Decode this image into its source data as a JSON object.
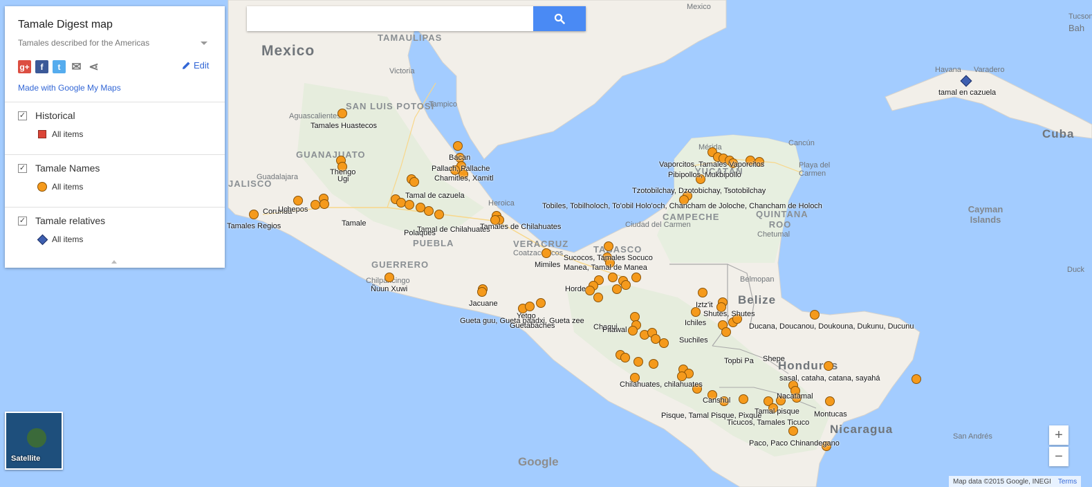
{
  "panel": {
    "title": "Tamale Digest map",
    "subtitle": "Tamales described for the Americas",
    "edit_label": "Edit",
    "made_with": "Made with Google My Maps",
    "social": [
      {
        "icon": "google-plus-icon",
        "glyph": "g+",
        "color": "#dc4e41"
      },
      {
        "icon": "facebook-icon",
        "glyph": "f",
        "color": "#3b5998"
      },
      {
        "icon": "twitter-icon",
        "glyph": "t",
        "color": "#55acee"
      },
      {
        "icon": "email-icon",
        "glyph": "✉",
        "color": "#7a7a7a"
      },
      {
        "icon": "share-icon",
        "glyph": "⋖",
        "color": "#7a7a7a"
      }
    ],
    "layers": [
      {
        "name": "Historical",
        "item_label": "All items",
        "legend_shape": "square",
        "legend_color": "#db4436"
      },
      {
        "name": "Tamale Names",
        "item_label": "All items",
        "legend_shape": "circle",
        "legend_color": "#f59a1c"
      },
      {
        "name": "Tamale relatives",
        "item_label": "All items",
        "legend_shape": "diamond",
        "legend_color": "#3e5fb0"
      }
    ]
  },
  "search": {
    "placeholder": "",
    "button_icon": "search-icon"
  },
  "map": {
    "places": [
      {
        "text": "Mexico",
        "kind": "country"
      },
      {
        "text": "TAMAULIPAS",
        "kind": "state"
      },
      {
        "text": "SAN LUIS POTOSÍ",
        "kind": "state"
      },
      {
        "text": "GUANAJUATO",
        "kind": "state"
      },
      {
        "text": "JALISCO",
        "kind": "state"
      },
      {
        "text": "PUEBLA",
        "kind": "state"
      },
      {
        "text": "GUERRERO",
        "kind": "state"
      },
      {
        "text": "VERACRUZ",
        "kind": "state"
      },
      {
        "text": "TABASCO",
        "kind": "state"
      },
      {
        "text": "CAMPECHE",
        "kind": "state"
      },
      {
        "text": "QUINTANA ROO",
        "kind": "state"
      },
      {
        "text": "YUCATÁN",
        "kind": "state"
      },
      {
        "text": "Belize",
        "kind": "country"
      },
      {
        "text": "Honduras",
        "kind": "country"
      },
      {
        "text": "Nicaragua",
        "kind": "country"
      },
      {
        "text": "Cuba",
        "kind": "country"
      },
      {
        "text": "Cayman Islands",
        "kind": "island"
      },
      {
        "text": "Victoria",
        "kind": "city"
      },
      {
        "text": "Tampico",
        "kind": "city"
      },
      {
        "text": "Aguascalientes",
        "kind": "city"
      },
      {
        "text": "Guadalajara",
        "kind": "city"
      },
      {
        "text": "Heroica",
        "kind": "city"
      },
      {
        "text": "Coatzacoalcos",
        "kind": "city"
      },
      {
        "text": "Chilpancingo",
        "kind": "city"
      },
      {
        "text": "Ciudad del Carmen",
        "kind": "city"
      },
      {
        "text": "Cancún",
        "kind": "city"
      },
      {
        "text": "Playa del Carmen",
        "kind": "city"
      },
      {
        "text": "Chetumal",
        "kind": "city"
      },
      {
        "text": "Belmopan",
        "kind": "city"
      },
      {
        "text": "Havana",
        "kind": "city"
      },
      {
        "text": "Varadero",
        "kind": "city"
      },
      {
        "text": "Mérida",
        "kind": "city"
      },
      {
        "text": "San Andrés",
        "kind": "city"
      },
      {
        "text": "Mexico",
        "kind": "city"
      },
      {
        "text": "Bah",
        "kind": "city"
      },
      {
        "text": "Duck",
        "kind": "city"
      },
      {
        "text": "Tucson",
        "kind": "city"
      }
    ],
    "labels": [
      "Tamales Huastecos",
      "Tamales Regios",
      "Ñuun Xuwi",
      "Bacan",
      "Pallach, Pallache",
      "Chamitles, Xamitl",
      "Tamal de cazuela",
      "Tamal de Chilahuates",
      "Tamales de Chilahuates",
      "Tobiles, Tobilholoch, To'obil Holo'och, Chancham de Joloche,  Chancham de Holoch",
      "Tzotobilchay, Dzotobichay, Tsotobilchay",
      "Vaporcitos, Tamales Vaporcitos",
      "Pibipollos, Mukbipollo",
      "Mimiles",
      "Sucocos, Tamales Socuco",
      "Manea, Tamal de Manea",
      "Gueta guu, Gueta paadxi, Gueta zee",
      "Guetabaches",
      "Yetgo",
      "Jacuane",
      "Iztz'it",
      "Ichiles",
      "Shutes, Shutes",
      "Ducana, Doucanou, Doukouna, Dukunu, Ducunu",
      "sasal, cataha, catana, sayahá",
      "Nacatamal",
      "Montucas",
      "Canshul",
      "Pisque, Tamal Pisque, Pixque",
      "Ticucos, Tamales Ticuco",
      "Paco, Paco Chinandegano",
      "Chilahuates, chilahuates",
      "Tamale",
      "tamal en cazuela",
      "Thengo",
      "Ugi",
      "Corunda",
      "Uchepos",
      "Polaques",
      "Horde",
      "Chaqui",
      "Pitawal",
      "Suchiles",
      "Topbi Pa",
      "Shepe",
      "Tamal pisque"
    ]
  },
  "satellite_label": "Satellite",
  "zoom": {
    "in": "+",
    "out": "−"
  },
  "footer": {
    "attribution": "Map data ©2015 Google, INEGI",
    "terms": "Terms"
  },
  "logo": "Google"
}
